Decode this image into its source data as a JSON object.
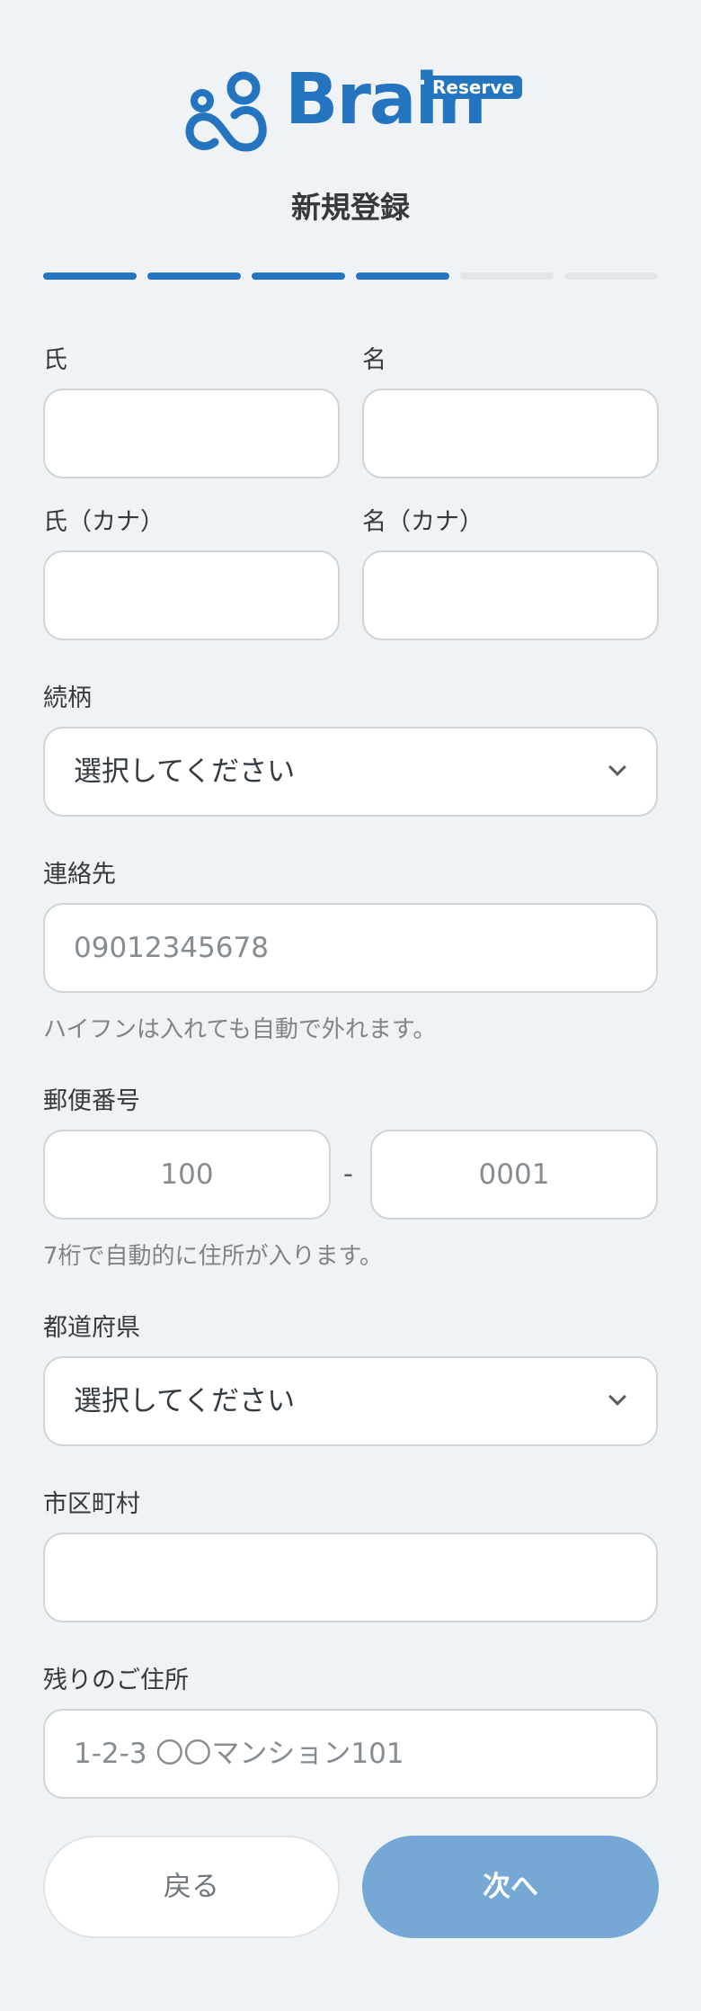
{
  "brand": {
    "name": "Brain",
    "badge": "Reserve"
  },
  "page_title": "新規登録",
  "progress": {
    "total_steps": 6,
    "completed_steps": 4
  },
  "form": {
    "last_name": {
      "label": "氏",
      "value": ""
    },
    "first_name": {
      "label": "名",
      "value": ""
    },
    "last_name_kana": {
      "label": "氏（カナ）",
      "value": ""
    },
    "first_name_kana": {
      "label": "名（カナ）",
      "value": ""
    },
    "relationship": {
      "label": "続柄",
      "selected": "選択してください"
    },
    "contact": {
      "label": "連絡先",
      "placeholder": "09012345678",
      "hint": "ハイフンは入れても自動で外れます。"
    },
    "postal_code": {
      "label": "郵便番号",
      "part1_placeholder": "100",
      "separator": "-",
      "part2_placeholder": "0001",
      "hint": "7桁で自動的に住所が入ります。"
    },
    "prefecture": {
      "label": "都道府県",
      "selected": "選択してください"
    },
    "city": {
      "label": "市区町村",
      "value": ""
    },
    "address_rest": {
      "label": "残りのご住所",
      "placeholder": "1-2-3 〇〇マンション101"
    }
  },
  "buttons": {
    "back": "戻る",
    "next": "次へ"
  },
  "colors": {
    "accent": "#2474c0",
    "next_button": "#75a8d4",
    "background": "#eff3f5"
  }
}
